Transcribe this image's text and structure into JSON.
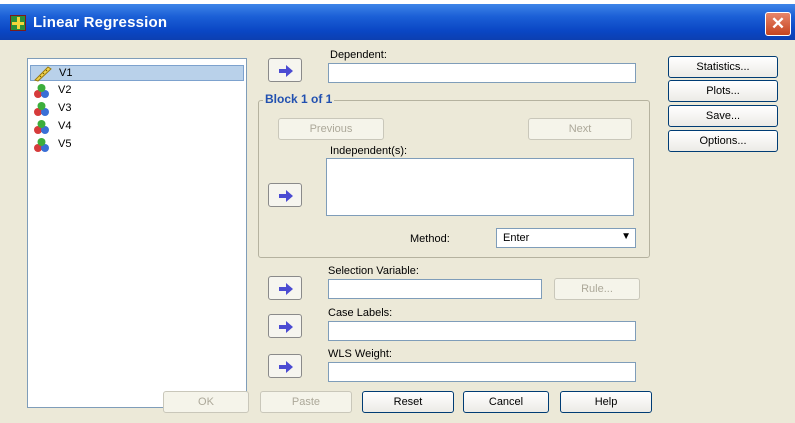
{
  "window": {
    "title": "Linear Regression",
    "close_glyph": "✕"
  },
  "variables": [
    {
      "name": "V1",
      "icon": "scale-ruler-icon",
      "selected": true
    },
    {
      "name": "V2",
      "icon": "nominal-variable-icon"
    },
    {
      "name": "V3",
      "icon": "nominal-variable-icon"
    },
    {
      "name": "V4",
      "icon": "nominal-variable-icon"
    },
    {
      "name": "V5",
      "icon": "nominal-variable-icon"
    }
  ],
  "dependent": {
    "label": "Dependent:",
    "value": ""
  },
  "block": {
    "title": "Block 1 of 1",
    "previous_label": "Previous",
    "next_label": "Next",
    "independent_label": "Independent(s):",
    "independent_value": "",
    "method_label": "Method:",
    "method_value": "Enter"
  },
  "selection_variable": {
    "label": "Selection Variable:",
    "value": "",
    "rule_label": "Rule..."
  },
  "case_labels": {
    "label": "Case Labels:",
    "value": ""
  },
  "wls_weight": {
    "label": "WLS Weight:",
    "value": ""
  },
  "side_buttons": {
    "statistics": "Statistics...",
    "plots": "Plots...",
    "save": "Save...",
    "options": "Options..."
  },
  "bottom_buttons": {
    "ok": "OK",
    "paste": "Paste",
    "reset": "Reset",
    "cancel": "Cancel",
    "help": "Help"
  },
  "colors": {
    "titlebar": "#0a46c4",
    "dialog_bg": "#ece9d8",
    "arrow": "#4b4bd2",
    "group_title": "#2150b0"
  }
}
